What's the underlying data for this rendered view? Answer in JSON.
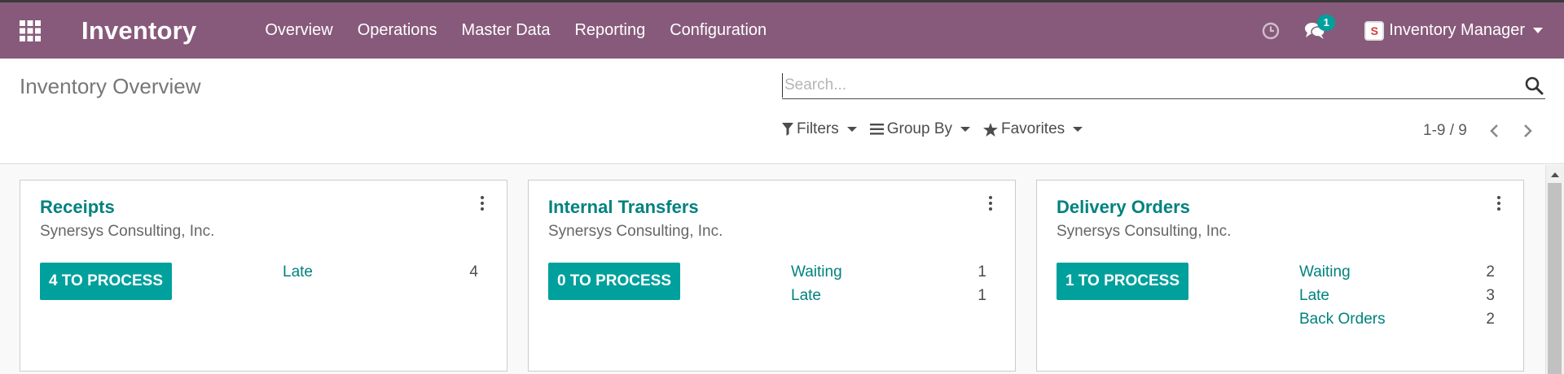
{
  "navbar": {
    "app_title": "Inventory",
    "menu": [
      "Overview",
      "Operations",
      "Master Data",
      "Reporting",
      "Configuration"
    ],
    "messages_count": "1",
    "avatar_text": "S",
    "user_name": "Inventory Manager",
    "bg_color": "#875a7b"
  },
  "control_panel": {
    "breadcrumb": "Inventory Overview",
    "search_placeholder": "Search...",
    "filters_label": "Filters",
    "groupby_label": "Group By",
    "favorites_label": "Favorites",
    "pager_value": "1-9 / 9"
  },
  "cards": [
    {
      "title": "Receipts",
      "company": "Synersys Consulting, Inc.",
      "button_label": "4 TO PROCESS",
      "stats": [
        {
          "label": "Late",
          "count": "4"
        }
      ]
    },
    {
      "title": "Internal Transfers",
      "company": "Synersys Consulting, Inc.",
      "button_label": "0 TO PROCESS",
      "stats": [
        {
          "label": "Waiting",
          "count": "1"
        },
        {
          "label": "Late",
          "count": "1"
        }
      ]
    },
    {
      "title": "Delivery Orders",
      "company": "Synersys Consulting, Inc.",
      "button_label": "1 TO PROCESS",
      "stats": [
        {
          "label": "Waiting",
          "count": "2"
        },
        {
          "label": "Late",
          "count": "3"
        },
        {
          "label": "Back Orders",
          "count": "2"
        }
      ]
    }
  ],
  "colors": {
    "accent": "#00a09d",
    "link": "#00827f"
  }
}
